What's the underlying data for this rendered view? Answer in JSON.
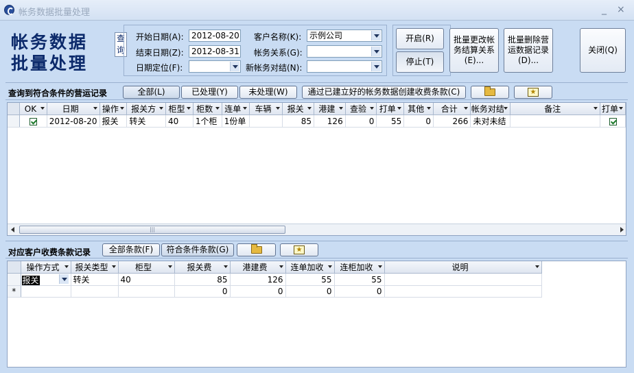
{
  "window": {
    "title": "帐务数据批量处理",
    "min_label": "_",
    "close_label": "×"
  },
  "header": {
    "title_line1": "帐务数据",
    "title_line2": "批量处理",
    "query_button": "查询"
  },
  "criteria": {
    "start_date_label": "开始日期(A):",
    "start_date": "2012-08-20",
    "end_date_label": "结束日期(Z):",
    "end_date": "2012-08-31",
    "date_locate_label": "日期定位(F):",
    "date_locate": "",
    "customer_label": "客户名称(K):",
    "customer": "示例公司",
    "account_relation_label": "帐务关系(G):",
    "account_relation": "",
    "new_settlement_label": "新帐务对结(N):",
    "new_settlement": ""
  },
  "controls": {
    "start": "开启(R)",
    "stop": "停止(T)",
    "batch_change": "批量更改帐务结算关系(E)...",
    "batch_delete": "批量删除营运数据记录(D)...",
    "close": "关闭(Q)"
  },
  "records": {
    "title": "查询到符合条件的营运记录",
    "filter_all": "全部(L)",
    "filter_processed": "已处理(Y)",
    "filter_unprocessed": "未处理(W)",
    "create_by_terms": "通过已建立好的帐务数据创建收费条款(C)",
    "open_icon": "folder-open-icon",
    "export_icon": "star-export-icon",
    "columns": [
      "OK",
      "日期",
      "操作",
      "报关方",
      "柜型",
      "柜数",
      "连单",
      "车辆",
      "报关",
      "港建",
      "查验",
      "打单",
      "其他",
      "合计",
      "帐务对结",
      "备注",
      "打单"
    ],
    "rows": [
      {
        "ok": true,
        "date": "2012-08-20",
        "op": "报关",
        "party": "转关",
        "ctype": "40",
        "ccount": "1个柜",
        "link": "1份单",
        "vehicle": "",
        "customs": "85",
        "port": "126",
        "inspect": "0",
        "print": "55",
        "other": "0",
        "total": "266",
        "settle": "未对未结",
        "note": "",
        "printed": true
      }
    ]
  },
  "fees": {
    "title": "对应客户收费条款记录",
    "all_terms": "全部条款(F)",
    "matching_terms": "符合条件条款(G)",
    "open_icon": "folder-open-icon",
    "export_icon": "star-export-icon",
    "columns": [
      "操作方式",
      "报关类型",
      "柜型",
      "报关费",
      "港建费",
      "连单加收",
      "连柜加收",
      "说明"
    ],
    "rows": [
      {
        "op": "报关",
        "type": "转关",
        "ctype": "40",
        "customs_fee": "85",
        "port_fee": "126",
        "link_fee": "55",
        "container_fee": "55",
        "note": ""
      }
    ],
    "new_row": {
      "marker": "*",
      "customs_fee": "0",
      "port_fee": "0",
      "link_fee": "0",
      "container_fee": "0"
    }
  },
  "colors": {
    "background": "#c9dcf3",
    "title_text": "#0c2a6b",
    "check": "#1b7a2a"
  }
}
